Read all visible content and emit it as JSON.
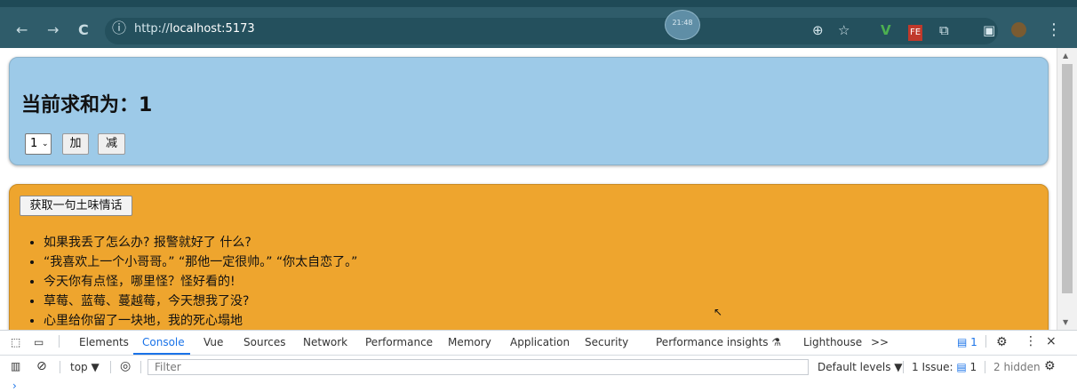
{
  "browser": {
    "back_icon": "←",
    "forward_icon": "→",
    "reload_icon": "C",
    "url_prefix": "http://",
    "url_host": "localhost:5173",
    "clock_text": "21:48",
    "icons": {
      "zoom": "⊕",
      "star": "☆",
      "vue": "V",
      "fe": "FE",
      "extensions": "⧉",
      "sidebar": "▣",
      "menu": "⋮"
    }
  },
  "counter": {
    "title": "当前求和为：1",
    "select_value": "1",
    "add_label": "加",
    "subtract_label": "减"
  },
  "love": {
    "button_label": "获取一句土味情话",
    "items": [
      "如果我丢了怎么办? 报警就好了 什么?",
      "“我喜欢上一个小哥哥。” “那他一定很帅。” “你太自恋了。”",
      "今天你有点怪，哪里怪？怪好看的!",
      "草莓、蓝莓、蔓越莓，今天想我了没?",
      "心里给你留了一块地，我的死心塌地"
    ]
  },
  "devtools": {
    "tabs": [
      "Elements",
      "Console",
      "Vue",
      "Sources",
      "Network",
      "Performance",
      "Memory",
      "Application",
      "Security",
      "Performance insights",
      "Lighthouse"
    ],
    "more_icon": ">>",
    "issue_count": "1",
    "top_label": "top",
    "filter_placeholder": "Filter",
    "default_levels": "Default levels",
    "issue_label": "1 Issue:",
    "issue_number": "1",
    "hidden_label": "2 hidden"
  }
}
